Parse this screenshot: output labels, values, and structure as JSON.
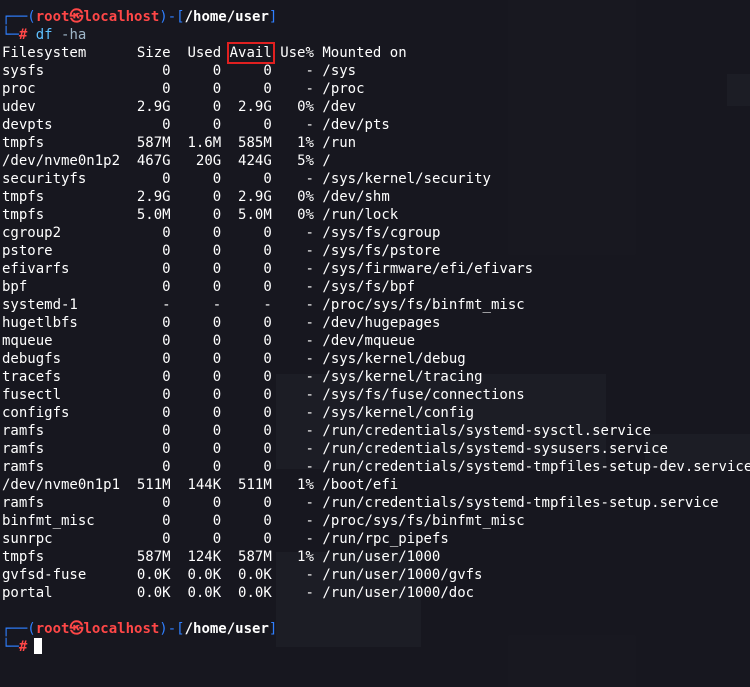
{
  "prompt": {
    "user": "root",
    "at": "㉿",
    "host": "localhost",
    "cwd": "/home/user",
    "symbol": "#"
  },
  "command": {
    "name": "df",
    "args": "-ha"
  },
  "table": {
    "headers": [
      "Filesystem",
      "Size",
      "Used",
      "Avail",
      "Use%",
      "Mounted on"
    ],
    "highlighted_header": "Avail",
    "rows": [
      [
        "sysfs",
        "0",
        "0",
        "0",
        "-",
        "/sys"
      ],
      [
        "proc",
        "0",
        "0",
        "0",
        "-",
        "/proc"
      ],
      [
        "udev",
        "2.9G",
        "0",
        "2.9G",
        "0%",
        "/dev"
      ],
      [
        "devpts",
        "0",
        "0",
        "0",
        "-",
        "/dev/pts"
      ],
      [
        "tmpfs",
        "587M",
        "1.6M",
        "585M",
        "1%",
        "/run"
      ],
      [
        "/dev/nvme0n1p2",
        "467G",
        "20G",
        "424G",
        "5%",
        "/"
      ],
      [
        "securityfs",
        "0",
        "0",
        "0",
        "-",
        "/sys/kernel/security"
      ],
      [
        "tmpfs",
        "2.9G",
        "0",
        "2.9G",
        "0%",
        "/dev/shm"
      ],
      [
        "tmpfs",
        "5.0M",
        "0",
        "5.0M",
        "0%",
        "/run/lock"
      ],
      [
        "cgroup2",
        "0",
        "0",
        "0",
        "-",
        "/sys/fs/cgroup"
      ],
      [
        "pstore",
        "0",
        "0",
        "0",
        "-",
        "/sys/fs/pstore"
      ],
      [
        "efivarfs",
        "0",
        "0",
        "0",
        "-",
        "/sys/firmware/efi/efivars"
      ],
      [
        "bpf",
        "0",
        "0",
        "0",
        "-",
        "/sys/fs/bpf"
      ],
      [
        "systemd-1",
        "-",
        "-",
        "-",
        "-",
        "/proc/sys/fs/binfmt_misc"
      ],
      [
        "hugetlbfs",
        "0",
        "0",
        "0",
        "-",
        "/dev/hugepages"
      ],
      [
        "mqueue",
        "0",
        "0",
        "0",
        "-",
        "/dev/mqueue"
      ],
      [
        "debugfs",
        "0",
        "0",
        "0",
        "-",
        "/sys/kernel/debug"
      ],
      [
        "tracefs",
        "0",
        "0",
        "0",
        "-",
        "/sys/kernel/tracing"
      ],
      [
        "fusectl",
        "0",
        "0",
        "0",
        "-",
        "/sys/fs/fuse/connections"
      ],
      [
        "configfs",
        "0",
        "0",
        "0",
        "-",
        "/sys/kernel/config"
      ],
      [
        "ramfs",
        "0",
        "0",
        "0",
        "-",
        "/run/credentials/systemd-sysctl.service"
      ],
      [
        "ramfs",
        "0",
        "0",
        "0",
        "-",
        "/run/credentials/systemd-sysusers.service"
      ],
      [
        "ramfs",
        "0",
        "0",
        "0",
        "-",
        "/run/credentials/systemd-tmpfiles-setup-dev.service"
      ],
      [
        "/dev/nvme0n1p1",
        "511M",
        "144K",
        "511M",
        "1%",
        "/boot/efi"
      ],
      [
        "ramfs",
        "0",
        "0",
        "0",
        "-",
        "/run/credentials/systemd-tmpfiles-setup.service"
      ],
      [
        "binfmt_misc",
        "0",
        "0",
        "0",
        "-",
        "/proc/sys/fs/binfmt_misc"
      ],
      [
        "sunrpc",
        "0",
        "0",
        "0",
        "-",
        "/run/rpc_pipefs"
      ],
      [
        "tmpfs",
        "587M",
        "124K",
        "587M",
        "1%",
        "/run/user/1000"
      ],
      [
        "gvfsd-fuse",
        "0.0K",
        "0.0K",
        "0.0K",
        "-",
        "/run/user/1000/gvfs"
      ],
      [
        "portal",
        "0.0K",
        "0.0K",
        "0.0K",
        "-",
        "/run/user/1000/doc"
      ]
    ]
  },
  "colors": {
    "bracket": "#2f7fff",
    "user": "#ff4747",
    "command": "#5ec0ff",
    "highlight_box": "#e02020"
  }
}
